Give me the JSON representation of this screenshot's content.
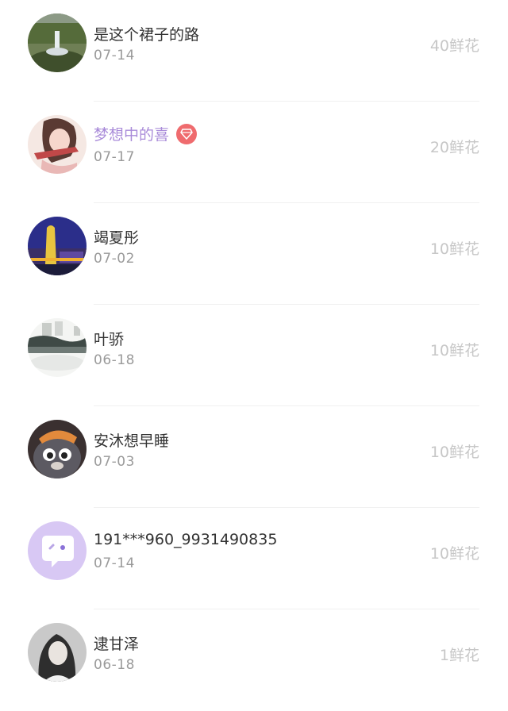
{
  "list": [
    {
      "name": "是这个裙子的路",
      "date": "07-14",
      "flowers": "40鲜花",
      "vip": false,
      "avatar_icon": "fountain-photo-avatar"
    },
    {
      "name": "梦想中的喜",
      "date": "07-17",
      "flowers": "20鲜花",
      "vip": true,
      "avatar_icon": "anime-girl-avatar"
    },
    {
      "name": "竭夏彤",
      "date": "07-02",
      "flowers": "10鲜花",
      "vip": false,
      "avatar_icon": "night-tower-avatar"
    },
    {
      "name": "叶骄",
      "date": "06-18",
      "flowers": "10鲜花",
      "vip": false,
      "avatar_icon": "ink-landscape-avatar"
    },
    {
      "name": "安沐想早睡",
      "date": "07-03",
      "flowers": "10鲜花",
      "vip": false,
      "avatar_icon": "cartoon-wolf-avatar"
    },
    {
      "name": "191***960_9931490835",
      "date": "07-14",
      "flowers": "10鲜花",
      "vip": false,
      "avatar_icon": "chat-bubble-avatar"
    },
    {
      "name": "逮甘泽",
      "date": "06-18",
      "flowers": "1鲜花",
      "vip": false,
      "avatar_icon": "portrait-photo-avatar"
    }
  ],
  "colors": {
    "name_text": "#333333",
    "vip_name_text": "#a98bd9",
    "date_text": "#9a9a9a",
    "flowers_text": "#c7c7c7",
    "vip_badge": "#ef6b6e",
    "divider": "#f0f0f0"
  }
}
